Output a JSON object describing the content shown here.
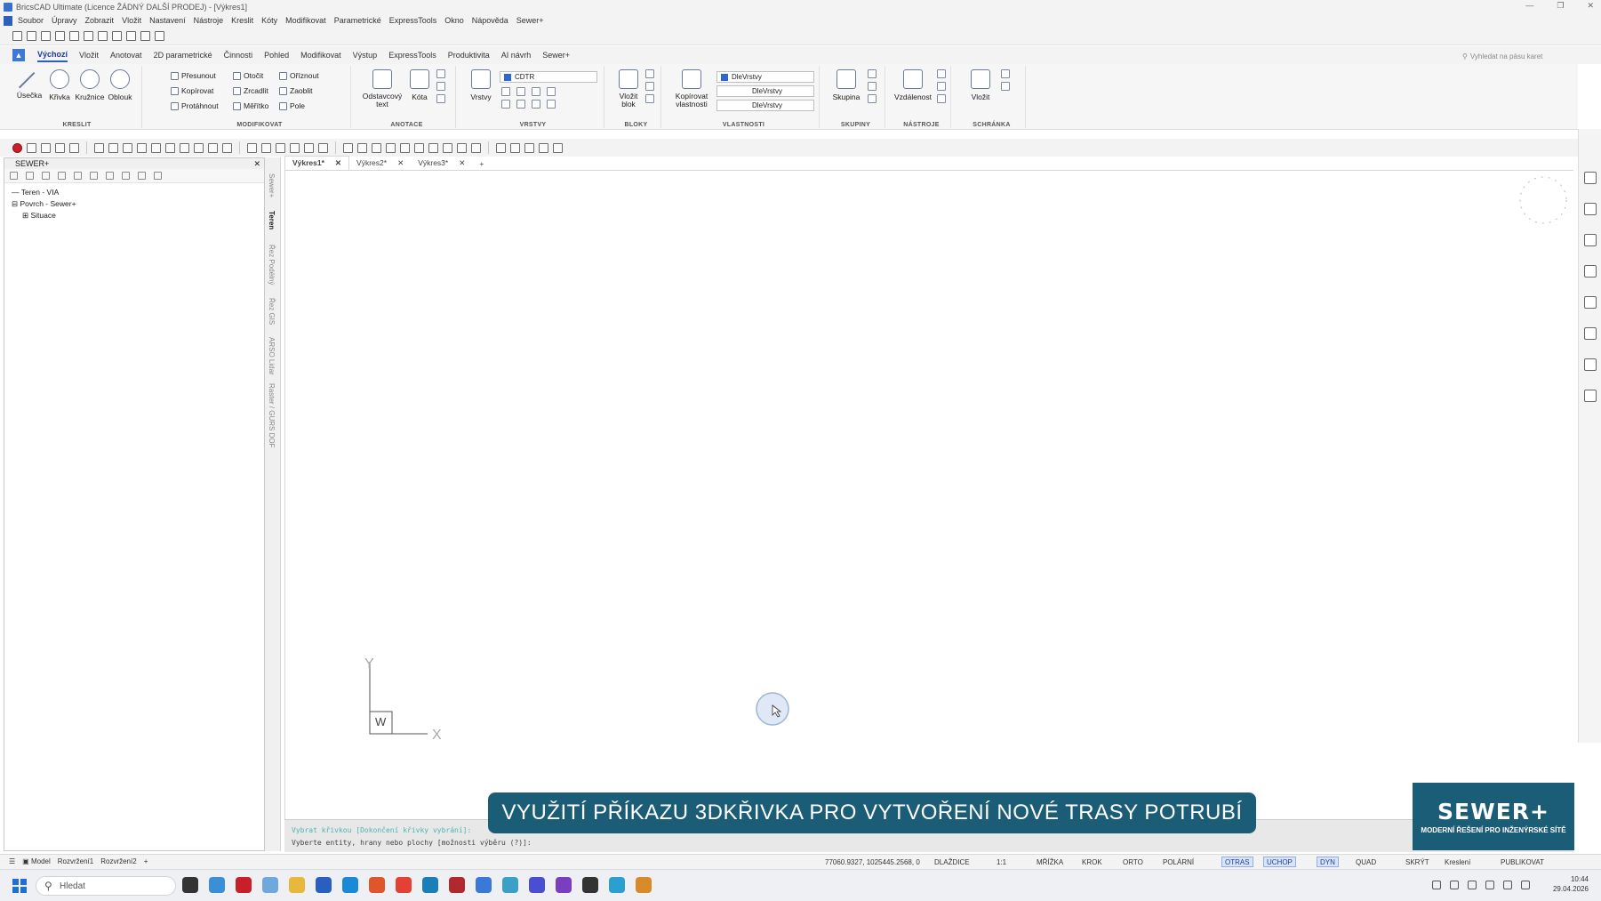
{
  "window": {
    "title": "BricsCAD Ultimate (Licence ŽÁDNÝ DALŠÍ PRODEJ) - [Výkres1]"
  },
  "menu": {
    "items": [
      "Soubor",
      "Úpravy",
      "Zobrazit",
      "Vložit",
      "Nastavení",
      "Nástroje",
      "Kreslit",
      "Kóty",
      "Modifikovat",
      "Parametrické",
      "ExpressTools",
      "Okno",
      "Nápověda",
      "Sewer+"
    ]
  },
  "ribbon": {
    "tabs": [
      "Výchozí",
      "Vložit",
      "Anotovat",
      "2D parametrické",
      "Činnosti",
      "Pohled",
      "Modifikovat",
      "Výstup",
      "ExpressTools",
      "Produktivita",
      "AI návrh",
      "Sewer+"
    ],
    "active_tab": "Výchozí",
    "search_placeholder": "Vyhledat na pásu karet",
    "groups": {
      "kreslit": {
        "title": "KRESLIT",
        "buttons": [
          "Úsečka",
          "Křivka",
          "Kružnice",
          "Oblouk"
        ]
      },
      "modifikovat": {
        "title": "MODIFIKOVAT",
        "buttons": [
          "Přesunout",
          "Otočit",
          "Oříznout",
          "Kopírovat",
          "Zrcadlit",
          "Zaoblit",
          "Protáhnout",
          "Měřítko",
          "Pole"
        ]
      },
      "anotace": {
        "title": "ANOTACE",
        "text_label": "Odstavcový text",
        "kota_label": "Kóta"
      },
      "vrstvy": {
        "title": "VRSTVY",
        "button": "Vrstvy",
        "layer_value": "CDTR"
      },
      "bloky": {
        "title": "BLOKY",
        "button": "Vložit blok"
      },
      "vlastnosti": {
        "title": "VLASTNOSTI",
        "button": "Kopírovat vlastnosti",
        "color_value": "DleVrstvy",
        "linetype_value": "DleVrstvy",
        "lineweight_value": "DleVrstvy"
      },
      "skupiny": {
        "title": "SKUPINY",
        "button": "Skupina"
      },
      "nastroje": {
        "title": "NÁSTROJE",
        "button": "Vzdálenost"
      },
      "schranka": {
        "title": "SCHRÁNKA",
        "button": "Vložit"
      }
    }
  },
  "left_panel": {
    "title": "SEWER+",
    "tree": [
      {
        "label": "Teren - VIA"
      },
      {
        "label": "Povrch - Sewer+",
        "children": [
          "Situace"
        ]
      }
    ],
    "side_tabs": [
      "Sewer+",
      "Teren",
      "Řez Podélný",
      "Řez GIS",
      "ARSO Lidar",
      "Raster / GURS DOF"
    ],
    "active_side_tab": "Teren"
  },
  "documents": {
    "tabs": [
      "Výkres1*",
      "Výkres2*",
      "Výkres3*"
    ],
    "active": "Výkres1*",
    "add_symbol": "+"
  },
  "ucs": {
    "y_label": "Y",
    "x_label": "X",
    "w_label": "W"
  },
  "command_line": {
    "history": "Vybrat křivkou [Dokončení křivky vybrání]:",
    "prompt": "Vyberte entity, hrany nebo plochy [možnosti výběru (?)]:"
  },
  "status_bar": {
    "layout_tabs": [
      "Model",
      "Rozvržení1",
      "Rozvržení2"
    ],
    "coordinates": "77060.9327, 1025445.2568, 0",
    "toggles": [
      {
        "label": "DLAŽDICE",
        "on": false
      },
      {
        "label": "1:1",
        "on": false
      },
      {
        "label": "MŘÍŽKA",
        "on": false
      },
      {
        "label": "KROK",
        "on": false
      },
      {
        "label": "ORTO",
        "on": false
      },
      {
        "label": "POLÁRNÍ",
        "on": false
      },
      {
        "label": "OTRAS",
        "on": true
      },
      {
        "label": "UCHOP",
        "on": true
      },
      {
        "label": "DYN",
        "on": true
      },
      {
        "label": "QUAD",
        "on": false
      },
      {
        "label": "SKRÝT",
        "on": false
      },
      {
        "label": "Kreslení",
        "on": false
      },
      {
        "label": "PUBLIKOVAT",
        "on": false
      }
    ]
  },
  "taskbar": {
    "search_placeholder": "Hledat",
    "time": "10:44",
    "date": "29.04.2026"
  },
  "overlay": {
    "banner_text": "VYUŽITÍ PŘÍKAZU 3DKŘIVKA PRO VYTVOŘENÍ NOVÉ TRASY POTRUBÍ",
    "brand_name": "SEWER+",
    "brand_tagline": "MODERNÍ ŘEŠENÍ PRO INŽENÝRSKÉ SÍTĚ"
  },
  "colors": {
    "accent": "#2f5fb8",
    "banner": "#1b5d77",
    "command_history": "#4fb3ae"
  }
}
